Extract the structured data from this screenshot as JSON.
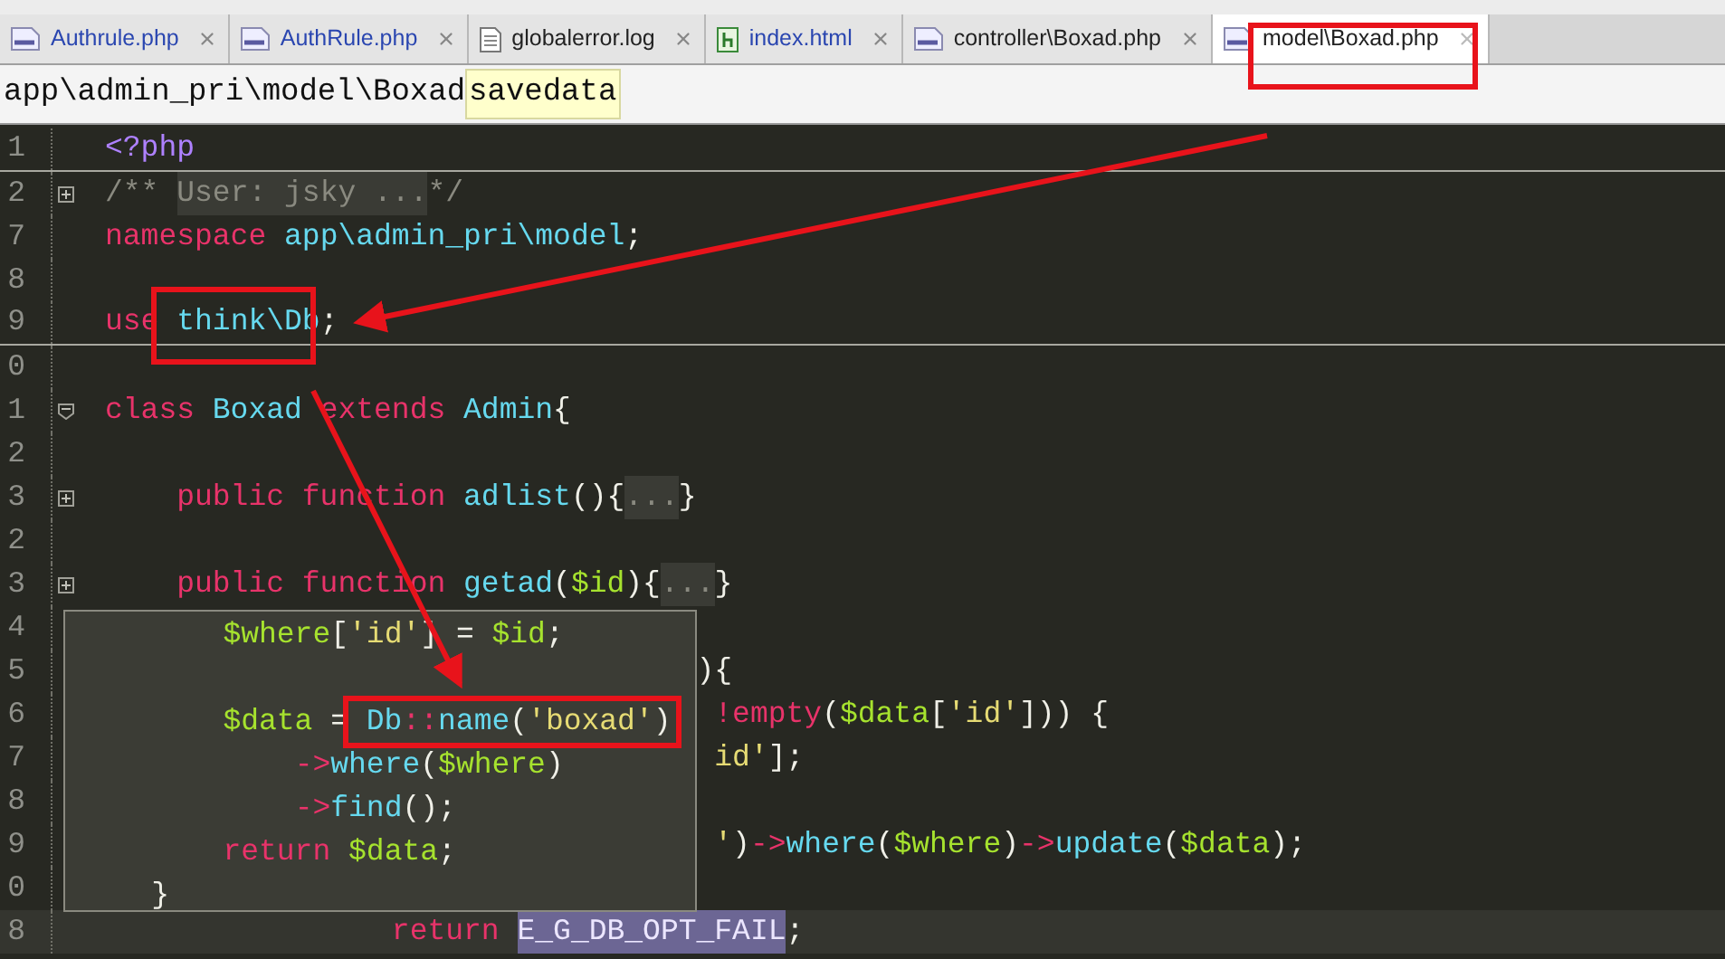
{
  "tabs": [
    {
      "label": "Authrule.php",
      "kind": "php",
      "modified": true,
      "selected": false
    },
    {
      "label": "AuthRule.php",
      "kind": "php",
      "modified": true,
      "selected": false
    },
    {
      "label": "globalerror.log",
      "kind": "text",
      "modified": false,
      "selected": false
    },
    {
      "label": "index.html",
      "kind": "html",
      "modified": true,
      "selected": false
    },
    {
      "label": "controller\\Boxad.php",
      "kind": "php",
      "modified": false,
      "selected": false
    },
    {
      "label": "model\\Boxad.php",
      "kind": "php",
      "modified": false,
      "selected": true
    }
  ],
  "breadcrumb": {
    "path": "app\\admin_pri\\model\\Boxad",
    "method": "savedata"
  },
  "lines": [
    {
      "number": "1",
      "separator_after": true,
      "current": false,
      "tokens": [
        {
          "kind": "tag",
          "text": "<?php"
        }
      ]
    },
    {
      "number": "2",
      "collapsed": true,
      "separator_after": false,
      "current": false,
      "tokens": [
        {
          "kind": "comment",
          "text": "/**"
        },
        {
          "kind": "folded",
          "text": " User: jsky ..."
        },
        {
          "kind": "comment",
          "text": "*/"
        }
      ]
    },
    {
      "number": "7",
      "separator_after": false,
      "current": false,
      "tokens": [
        {
          "kind": "keyword",
          "text": "namespace "
        },
        {
          "kind": "ident",
          "text": "app\\admin_pri\\model"
        },
        {
          "kind": "punct",
          "text": ";"
        }
      ]
    },
    {
      "number": "8",
      "separator_after": false,
      "current": false
    },
    {
      "number": "9",
      "separator_after": true,
      "current": false,
      "tokens": [
        {
          "kind": "keyword",
          "text": "use "
        },
        {
          "kind": "ident",
          "text": "think\\Db"
        },
        {
          "kind": "punct",
          "text": ";"
        }
      ]
    },
    {
      "number": "0",
      "separator_after": false,
      "current": false
    },
    {
      "number": "1",
      "collapsed": false,
      "separator_after": false,
      "current": false,
      "tokens": [
        {
          "kind": "keyword",
          "text": "class "
        },
        {
          "kind": "ident",
          "text": "Boxad "
        },
        {
          "kind": "keyword",
          "text": "extends "
        },
        {
          "kind": "ident",
          "text": "Admin"
        },
        {
          "kind": "punct",
          "text": "{"
        }
      ]
    },
    {
      "number": "2",
      "separator_after": false,
      "current": false
    },
    {
      "number": "3",
      "collapsed": true,
      "separator_after": false,
      "current": false,
      "tokens": [
        {
          "kind": "keyword",
          "text": "    public function "
        },
        {
          "kind": "ident",
          "text": "adlist"
        },
        {
          "kind": "punct",
          "text": "(){"
        },
        {
          "kind": "folded",
          "text": "..."
        },
        {
          "kind": "punct",
          "text": "}"
        }
      ]
    },
    {
      "number": "2",
      "separator_after": false,
      "current": false
    },
    {
      "number": "3",
      "collapsed": true,
      "separator_after": false,
      "current": false,
      "tokens": [
        {
          "kind": "keyword",
          "text": "    public function "
        },
        {
          "kind": "ident",
          "text": "getad"
        },
        {
          "kind": "punct",
          "text": "("
        },
        {
          "kind": "var",
          "text": "$id"
        },
        {
          "kind": "punct",
          "text": "){"
        },
        {
          "kind": "folded",
          "text": "..."
        },
        {
          "kind": "punct",
          "text": "}"
        }
      ]
    },
    {
      "number": "4",
      "separator_after": false,
      "current": false
    },
    {
      "number": "5",
      "separator_after": false,
      "current": false,
      "tokens": [
        {
          "kind": "punct",
          "text": "                                 ){"
        }
      ]
    },
    {
      "number": "6",
      "separator_after": false,
      "current": false,
      "tokens": [
        {
          "kind": "keyword",
          "text": "                                  !empty"
        },
        {
          "kind": "punct",
          "text": "("
        },
        {
          "kind": "var",
          "text": "$data"
        },
        {
          "kind": "punct",
          "text": "["
        },
        {
          "kind": "string",
          "text": "'id'"
        },
        {
          "kind": "punct",
          "text": "])) {"
        }
      ]
    },
    {
      "number": "7",
      "separator_after": false,
      "current": false,
      "tokens": [
        {
          "kind": "string",
          "text": "                                  id'"
        },
        {
          "kind": "punct",
          "text": "];"
        }
      ]
    },
    {
      "number": "8",
      "separator_after": false,
      "current": false
    },
    {
      "number": "9",
      "separator_after": false,
      "current": false,
      "tokens": [
        {
          "kind": "string",
          "text": "                                  '"
        },
        {
          "kind": "punct",
          "text": ")"
        },
        {
          "kind": "keyword",
          "text": "->"
        },
        {
          "kind": "ident",
          "text": "where"
        },
        {
          "kind": "punct",
          "text": "("
        },
        {
          "kind": "var",
          "text": "$where"
        },
        {
          "kind": "punct",
          "text": ")"
        },
        {
          "kind": "keyword",
          "text": "->"
        },
        {
          "kind": "ident",
          "text": "update"
        },
        {
          "kind": "punct",
          "text": "("
        },
        {
          "kind": "var",
          "text": "$data"
        },
        {
          "kind": "punct",
          "text": ");"
        }
      ]
    },
    {
      "number": "0",
      "separator_after": false,
      "current": false
    },
    {
      "number": "8",
      "separator_after": false,
      "current": true,
      "tokens": [
        {
          "kind": "keyword",
          "text": "                return "
        },
        {
          "kind": "selection",
          "text": "E_G_DB_OPT_FAIL"
        },
        {
          "kind": "punct",
          "text": ";"
        }
      ]
    }
  ],
  "popup": {
    "lines": [
      {
        "kind": "code",
        "tokens": [
          {
            "kind": "var",
            "text": "        $where"
          },
          {
            "kind": "punct",
            "text": "["
          },
          {
            "kind": "string",
            "text": "'id'"
          },
          {
            "kind": "punct",
            "text": "] = "
          },
          {
            "kind": "var",
            "text": "$id"
          },
          {
            "kind": "punct",
            "text": ";"
          }
        ]
      },
      {
        "kind": "blank"
      },
      {
        "kind": "code",
        "tokens": [
          {
            "kind": "var",
            "text": "        $data"
          },
          {
            "kind": "punct",
            "text": " = "
          },
          {
            "kind": "ident",
            "text": "Db"
          },
          {
            "kind": "keyword",
            "text": "::"
          },
          {
            "kind": "ident",
            "text": "name"
          },
          {
            "kind": "punct",
            "text": "("
          },
          {
            "kind": "string",
            "text": "'boxad'"
          },
          {
            "kind": "punct",
            "text": ")"
          }
        ]
      },
      {
        "kind": "code",
        "tokens": [
          {
            "kind": "keyword",
            "text": "            ->"
          },
          {
            "kind": "ident",
            "text": "where"
          },
          {
            "kind": "punct",
            "text": "("
          },
          {
            "kind": "var",
            "text": "$where"
          },
          {
            "kind": "punct",
            "text": ")"
          }
        ]
      },
      {
        "kind": "code",
        "tokens": [
          {
            "kind": "keyword",
            "text": "            ->"
          },
          {
            "kind": "ident",
            "text": "find"
          },
          {
            "kind": "punct",
            "text": "();"
          }
        ]
      },
      {
        "kind": "code",
        "tokens": [
          {
            "kind": "keyword",
            "text": "        return "
          },
          {
            "kind": "var",
            "text": "$data"
          },
          {
            "kind": "punct",
            "text": ";"
          }
        ]
      },
      {
        "kind": "code",
        "tokens": [
          {
            "kind": "punct",
            "text": "    }"
          }
        ]
      }
    ]
  }
}
